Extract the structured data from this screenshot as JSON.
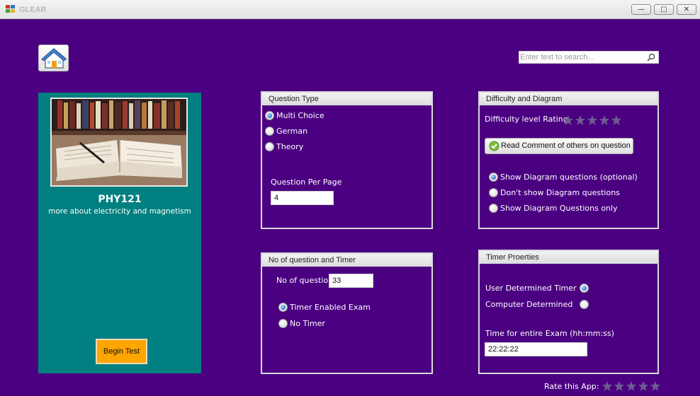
{
  "window": {
    "title": "GLEAR",
    "controls": [
      "—",
      "▢",
      "✕"
    ]
  },
  "search": {
    "placeholder": "Enter text to search..."
  },
  "course": {
    "code": "PHY121",
    "description": "more about electricity and magnetism",
    "begin_label": "Begin Test"
  },
  "question_type": {
    "title": "Question Type",
    "options": [
      {
        "label": "Multi Choice",
        "checked": true
      },
      {
        "label": "German",
        "checked": false
      },
      {
        "label": "Theory",
        "checked": false
      }
    ],
    "per_page_label": "Question Per Page",
    "per_page_value": "4"
  },
  "difficulty": {
    "title": "Difficulty and Diagram",
    "rating_label": "Difficulty level Rating",
    "rating": 0,
    "comment_button": "Read Comment of others on question",
    "diagram_options": [
      {
        "label": "Show Diagram questions (optional)",
        "checked": true
      },
      {
        "label": "Don't show Diagram questions",
        "checked": false
      },
      {
        "label": "Show Diagram Questions only",
        "checked": false
      }
    ]
  },
  "questions_timer": {
    "title": "No of question and Timer",
    "count_label": "No of question",
    "count_value": "33",
    "options": [
      {
        "label": "Timer Enabled Exam",
        "checked": true
      },
      {
        "label": "No Timer",
        "checked": false
      }
    ]
  },
  "timer_properties": {
    "title": "Timer Proerties",
    "options": [
      {
        "label": "User Determined Timer",
        "checked": true
      },
      {
        "label": "Computer Determined",
        "checked": false
      }
    ],
    "time_label": "Time for entire Exam (hh:mm:ss)",
    "time_value": "22:22:22"
  },
  "footer": {
    "rate_label": "Rate this App:",
    "rating": 0
  },
  "colors": {
    "background": "#4b0082",
    "card": "#008080",
    "begin_button": "#ffa500",
    "star_empty": "#6d5c8f"
  },
  "icons": [
    "home-icon",
    "search-icon",
    "book-photo",
    "check-icon",
    "star-icon"
  ]
}
